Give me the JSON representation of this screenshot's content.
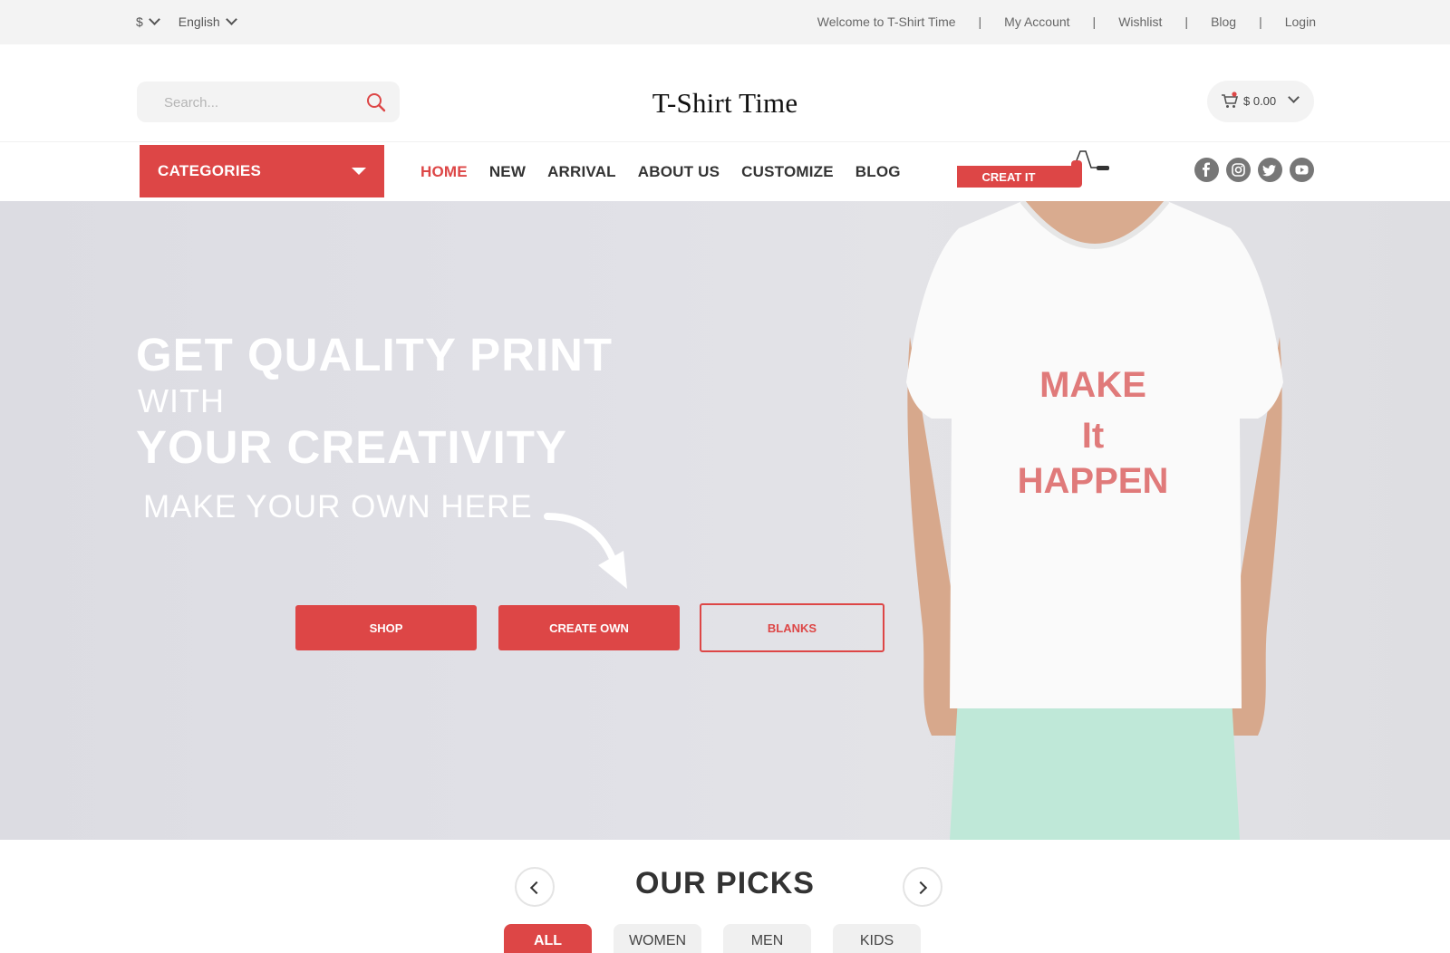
{
  "topbar": {
    "currency": "$",
    "language": "English",
    "welcome": "Welcome to T-Shirt Time",
    "links": [
      "My Account",
      "Wishlist",
      "Blog",
      "Login"
    ],
    "separator": "|"
  },
  "header": {
    "search_placeholder": "Search...",
    "logo": "T-Shirt Time",
    "cart_amount": "$ 0.00"
  },
  "nav": {
    "categories_label": "CATEGORIES",
    "items": [
      "HOME",
      "NEW",
      "ARRIVAL",
      "ABOUT US",
      "CUSTOMIZE",
      "BLOG"
    ],
    "active_item": "HOME",
    "creat_label": "CREAT IT",
    "social": [
      "facebook-icon",
      "instagram-icon",
      "twitter-icon",
      "youtube-icon"
    ]
  },
  "hero": {
    "line1": "GET QUALITY PRINT",
    "line2": "WITH",
    "line3": "YOUR CREATIVITY",
    "subline": "MAKE YOUR OWN HERE",
    "shirt_text": [
      "MAKE",
      "It",
      "HAPPEN"
    ],
    "buttons": {
      "shop": "SHOP",
      "create_own": "CREATE OWN",
      "blanks": "BLANKS"
    }
  },
  "picks": {
    "title": "OUR PICKS",
    "filters": [
      "ALL",
      "WOMEN",
      "MEN",
      "KIDS"
    ],
    "active_filter": "ALL"
  },
  "colors": {
    "accent": "#dd4646",
    "topbar_bg": "#f3f3f3",
    "hero_bg": "#e0e0e6"
  }
}
